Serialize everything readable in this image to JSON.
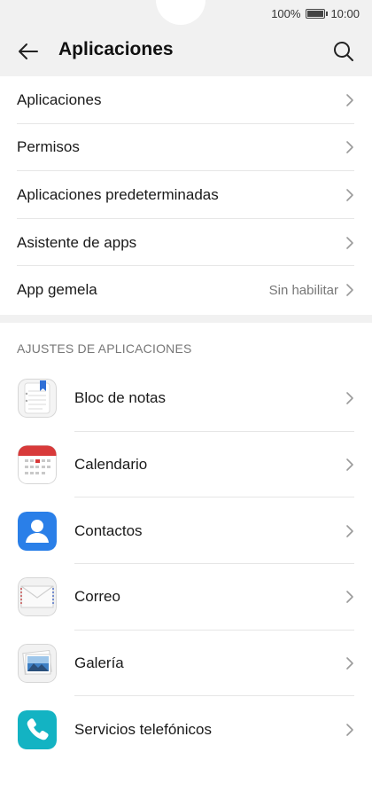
{
  "status_bar": {
    "battery_percent": "100%",
    "time": "10:00"
  },
  "header": {
    "title": "Aplicaciones"
  },
  "menu": [
    {
      "label": "Aplicaciones"
    },
    {
      "label": "Permisos"
    },
    {
      "label": "Aplicaciones predeterminadas"
    },
    {
      "label": "Asistente de apps"
    },
    {
      "label": "App gemela",
      "value": "Sin habilitar"
    }
  ],
  "section": {
    "title": "AJUSTES DE APLICACIONES"
  },
  "apps": [
    {
      "label": "Bloc de notas",
      "icon": "notepad-icon"
    },
    {
      "label": "Calendario",
      "icon": "calendar-icon"
    },
    {
      "label": "Contactos",
      "icon": "contacts-icon"
    },
    {
      "label": "Correo",
      "icon": "mail-icon"
    },
    {
      "label": "Galería",
      "icon": "gallery-icon"
    },
    {
      "label": "Servicios telefónicos",
      "icon": "phone-icon"
    }
  ],
  "colors": {
    "header_bg": "#f1f1f1",
    "contacts_blue": "#2a7fe8",
    "phone_teal": "#13b3c3",
    "calendar_red": "#d83a3a",
    "notepad_blue": "#2f6fd6"
  }
}
